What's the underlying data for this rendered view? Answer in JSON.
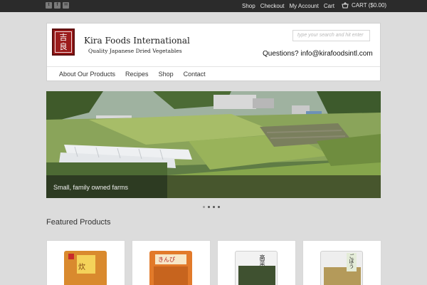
{
  "topbar": {
    "nav": [
      "Shop",
      "Checkout",
      "My Account",
      "Cart"
    ],
    "cart_label": "CART ($0.00)",
    "social_icons": [
      "twitter-icon",
      "facebook-icon",
      "email-icon"
    ]
  },
  "header": {
    "logo_glyphs": [
      "吉",
      "良"
    ],
    "brand_name": "Kira Foods International",
    "tagline": "Quality Japanese Dried Vegetables",
    "search_placeholder": "type your search and hit enter",
    "questions": "Questions?  info@kirafoodsintl.com"
  },
  "mainnav": [
    "About Our Products",
    "Recipes",
    "Shop",
    "Contact"
  ],
  "hero": {
    "caption": "Small, family owned farms",
    "slides": 4,
    "active_slide": 2
  },
  "featured": {
    "title": "Featured Products",
    "products": [
      {
        "glyph": "炊"
      },
      {
        "glyph": "きんぴ"
      },
      {
        "glyph": "高菜"
      },
      {
        "glyph": "ごぼう"
      }
    ]
  },
  "colors": {
    "topbar": "#2b2b2b",
    "page_bg": "#dcdcdc",
    "logo_red": "#9b1b1b"
  }
}
